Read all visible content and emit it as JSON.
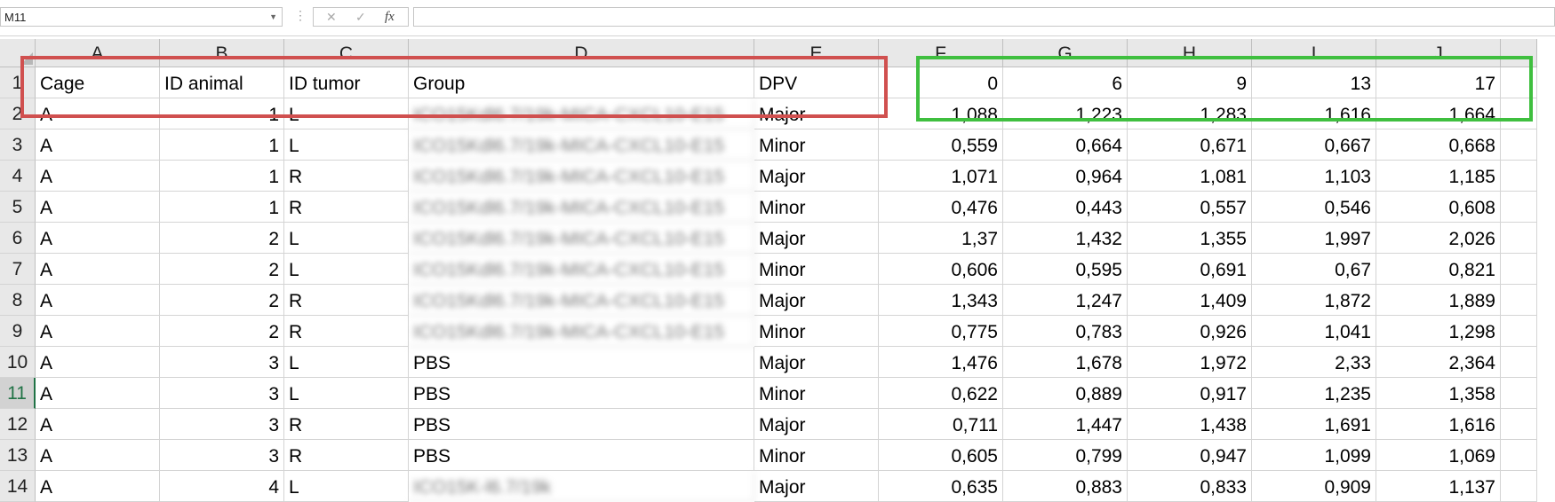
{
  "formula_bar": {
    "name_box": "M11",
    "cancel_icon": "✕",
    "enter_icon": "✓",
    "fx_label": "fx",
    "formula": ""
  },
  "columns": [
    "A",
    "B",
    "C",
    "D",
    "E",
    "F",
    "G",
    "H",
    "I",
    "J",
    ""
  ],
  "selected_row": "11",
  "header_row": {
    "row": "1",
    "cells": [
      "Cage",
      "ID animal",
      "ID tumor",
      "Group",
      "DPV",
      "0",
      "6",
      "9",
      "13",
      "17"
    ]
  },
  "rows": [
    {
      "row": "2",
      "cage": "A",
      "id_animal": "1",
      "id_tumor": "L",
      "group": "ICO15Kdl6.7/19k-MICA-CXCL10-E15",
      "dpv": "Major",
      "v0": "1,088",
      "v6": "1,223",
      "v9": "1,283",
      "v13": "1,616",
      "v17": "1,664"
    },
    {
      "row": "3",
      "cage": "A",
      "id_animal": "1",
      "id_tumor": "L",
      "group": "ICO15Kdl6.7/19k-MICA-CXCL10-E15",
      "dpv": "Minor",
      "v0": "0,559",
      "v6": "0,664",
      "v9": "0,671",
      "v13": "0,667",
      "v17": "0,668"
    },
    {
      "row": "4",
      "cage": "A",
      "id_animal": "1",
      "id_tumor": "R",
      "group": "ICO15Kdl6.7/19k-MICA-CXCL10-E15",
      "dpv": "Major",
      "v0": "1,071",
      "v6": "0,964",
      "v9": "1,081",
      "v13": "1,103",
      "v17": "1,185"
    },
    {
      "row": "5",
      "cage": "A",
      "id_animal": "1",
      "id_tumor": "R",
      "group": "ICO15Kdl6.7/19k-MICA-CXCL10-E15",
      "dpv": "Minor",
      "v0": "0,476",
      "v6": "0,443",
      "v9": "0,557",
      "v13": "0,546",
      "v17": "0,608"
    },
    {
      "row": "6",
      "cage": "A",
      "id_animal": "2",
      "id_tumor": "L",
      "group": "ICO15Kdl6.7/19k-MICA-CXCL10-E15",
      "dpv": "Major",
      "v0": "1,37",
      "v6": "1,432",
      "v9": "1,355",
      "v13": "1,997",
      "v17": "2,026"
    },
    {
      "row": "7",
      "cage": "A",
      "id_animal": "2",
      "id_tumor": "L",
      "group": "ICO15Kdl6.7/19k-MICA-CXCL10-E15",
      "dpv": "Minor",
      "v0": "0,606",
      "v6": "0,595",
      "v9": "0,691",
      "v13": "0,67",
      "v17": "0,821"
    },
    {
      "row": "8",
      "cage": "A",
      "id_animal": "2",
      "id_tumor": "R",
      "group": "ICO15Kdl6.7/19k-MICA-CXCL10-E15",
      "dpv": "Major",
      "v0": "1,343",
      "v6": "1,247",
      "v9": "1,409",
      "v13": "1,872",
      "v17": "1,889"
    },
    {
      "row": "9",
      "cage": "A",
      "id_animal": "2",
      "id_tumor": "R",
      "group": "ICO15Kdl6.7/19k-MICA-CXCL10-E15",
      "dpv": "Minor",
      "v0": "0,775",
      "v6": "0,783",
      "v9": "0,926",
      "v13": "1,041",
      "v17": "1,298"
    },
    {
      "row": "10",
      "cage": "A",
      "id_animal": "3",
      "id_tumor": "L",
      "group": "PBS",
      "dpv": "Major",
      "v0": "1,476",
      "v6": "1,678",
      "v9": "1,972",
      "v13": "2,33",
      "v17": "2,364"
    },
    {
      "row": "11",
      "cage": "A",
      "id_animal": "3",
      "id_tumor": "L",
      "group": "PBS",
      "dpv": "Minor",
      "v0": "0,622",
      "v6": "0,889",
      "v9": "0,917",
      "v13": "1,235",
      "v17": "1,358"
    },
    {
      "row": "12",
      "cage": "A",
      "id_animal": "3",
      "id_tumor": "R",
      "group": "PBS",
      "dpv": "Major",
      "v0": "0,711",
      "v6": "1,447",
      "v9": "1,438",
      "v13": "1,691",
      "v17": "1,616"
    },
    {
      "row": "13",
      "cage": "A",
      "id_animal": "3",
      "id_tumor": "R",
      "group": "PBS",
      "dpv": "Minor",
      "v0": "0,605",
      "v6": "0,799",
      "v9": "0,947",
      "v13": "1,099",
      "v17": "1,069"
    },
    {
      "row": "14",
      "cage": "A",
      "id_animal": "4",
      "id_tumor": "L",
      "group": "ICO15K-l6.7/19k",
      "dpv": "Major",
      "v0": "0,635",
      "v6": "0,883",
      "v9": "0,833",
      "v13": "0,909",
      "v17": "1,137"
    }
  ],
  "blurred_groups": true,
  "annotations": {
    "red_box_color": "#d0504f",
    "green_box_color": "#3fbf3f"
  }
}
